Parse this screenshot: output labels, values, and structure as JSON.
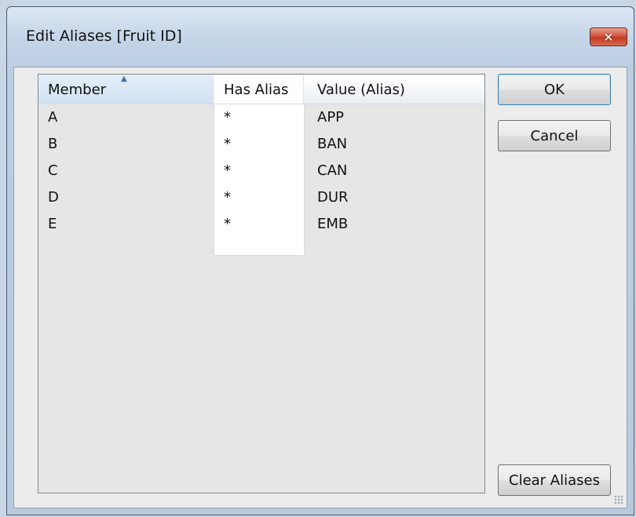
{
  "window": {
    "title": "Edit Aliases [Fruit ID]",
    "close_glyph": "✕"
  },
  "list": {
    "columns": [
      "Member",
      "Has Alias",
      "Value (Alias)"
    ],
    "sort_indicator": "▲",
    "rows": [
      {
        "member": "A",
        "has_alias": "*",
        "value": "APP"
      },
      {
        "member": "B",
        "has_alias": "*",
        "value": "BAN"
      },
      {
        "member": "C",
        "has_alias": "*",
        "value": "CAN"
      },
      {
        "member": "D",
        "has_alias": "*",
        "value": "DUR"
      },
      {
        "member": "E",
        "has_alias": "*",
        "value": "EMB"
      }
    ]
  },
  "buttons": {
    "ok": "OK",
    "cancel": "Cancel",
    "clear_aliases": "Clear Aliases"
  },
  "icons": {
    "close": "close-icon",
    "sort": "sort-ascending-icon",
    "resize": "resize-grip-icon"
  },
  "colors": {
    "close_button": "#c23a22",
    "ok_border": "#3c7fb1",
    "header_selected": "#d2e2f4"
  }
}
